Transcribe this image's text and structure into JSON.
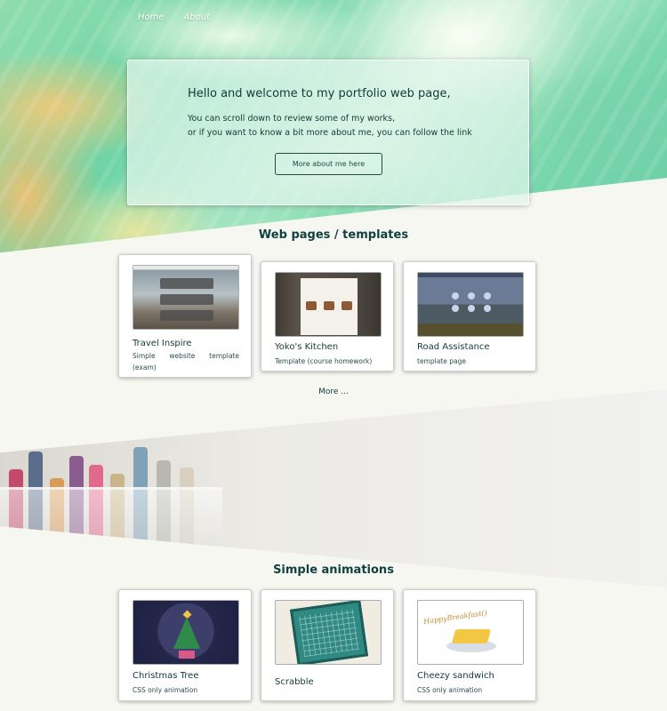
{
  "nav": {
    "items": [
      "Home",
      "About"
    ]
  },
  "hero": {
    "title": "Hello and welcome to my portfolio web page,",
    "line1": "You can scroll down to review some of my works,",
    "line2": "or if you want to know a bit more about me, you can follow the link",
    "button": "More about me here"
  },
  "web_section": {
    "title": "Web pages / templates",
    "more": "More ...",
    "cards": [
      {
        "title": "Travel Inspire",
        "desc": "Simple website template (exam)",
        "thumb": "travel-screenshot"
      },
      {
        "title": "Yoko's Kitchen",
        "desc": "Template (course homework)",
        "thumb": "kitchen-screenshot"
      },
      {
        "title": "Road Assistance",
        "desc": "template page",
        "thumb": "road-assistance-screenshot"
      }
    ]
  },
  "anim_section": {
    "title": "Simple animations",
    "cards": [
      {
        "title": "Christmas Tree",
        "desc": "CSS only animation",
        "thumb": "christmas-tree-image"
      },
      {
        "title": "Scrabble",
        "desc": "",
        "thumb": "scrabble-board-image"
      },
      {
        "title": "Cheezy sandwich",
        "desc": "CSS only animation",
        "thumb": "sandwich-image",
        "thumb_text": "HappyBreakfast()"
      }
    ]
  },
  "colors": {
    "text": "#123c3c",
    "background": "#f6f7f1",
    "marble_green": "#6fd4a6",
    "marble_yellow": "#f0c878"
  }
}
